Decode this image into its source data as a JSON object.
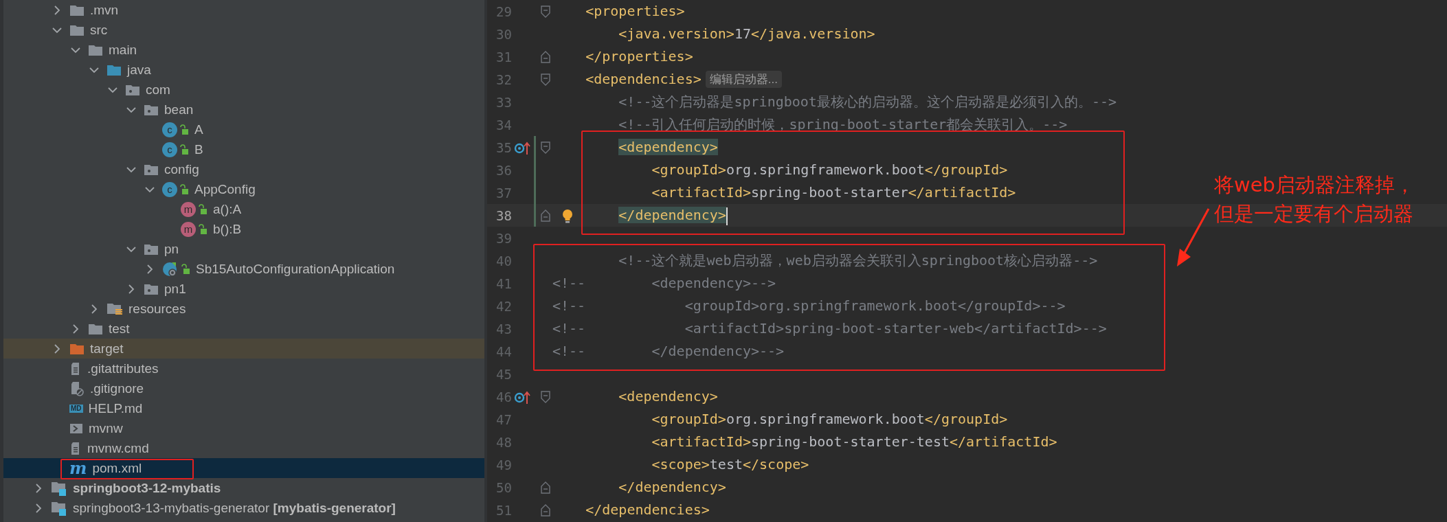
{
  "project_tree": {
    "items": [
      {
        "label": ".mvn",
        "kind": "folder",
        "expanded": false,
        "selected": false
      },
      {
        "label": "src",
        "kind": "folder",
        "expanded": true,
        "selected": false,
        "children": [
          {
            "label": "main",
            "kind": "folder",
            "expanded": true,
            "selected": false,
            "children": [
              {
                "label": "java",
                "kind": "source-root",
                "expanded": true,
                "selected": false,
                "children": [
                  {
                    "label": "com",
                    "kind": "package",
                    "expanded": true,
                    "selected": false,
                    "children": [
                      {
                        "label": "bean",
                        "kind": "package",
                        "expanded": true,
                        "selected": false,
                        "children": [
                          {
                            "label": "A",
                            "kind": "class",
                            "icon_letter": "c",
                            "selected": false
                          },
                          {
                            "label": "B",
                            "kind": "class",
                            "icon_letter": "c",
                            "selected": false
                          }
                        ]
                      },
                      {
                        "label": "config",
                        "kind": "package",
                        "expanded": true,
                        "selected": false,
                        "children": [
                          {
                            "label": "AppConfig",
                            "kind": "class",
                            "icon_letter": "c",
                            "expanded": true,
                            "selected": false,
                            "children": [
                              {
                                "label": "a():A",
                                "kind": "method",
                                "icon_letter": "m",
                                "selected": false
                              },
                              {
                                "label": "b():B",
                                "kind": "method",
                                "icon_letter": "m",
                                "selected": false
                              }
                            ]
                          }
                        ]
                      },
                      {
                        "label": "pn",
                        "kind": "package",
                        "expanded": true,
                        "selected": false,
                        "children": [
                          {
                            "label": "Sb15AutoConfigurationApplication",
                            "kind": "app",
                            "expanded": false,
                            "selected": false
                          }
                        ]
                      },
                      {
                        "label": "pn1",
                        "kind": "package",
                        "expanded": false,
                        "selected": false
                      }
                    ]
                  }
                ]
              },
              {
                "label": "resources",
                "kind": "resources",
                "expanded": false,
                "selected": false
              }
            ]
          },
          {
            "label": "test",
            "kind": "folder",
            "expanded": false,
            "selected": false
          }
        ]
      },
      {
        "label": "target",
        "kind": "excluded",
        "expanded": false,
        "selected": false
      },
      {
        "label": ".gitattributes",
        "kind": "file",
        "selected": false
      },
      {
        "label": ".gitignore",
        "kind": "ignore-file",
        "selected": false
      },
      {
        "label": "HELP.md",
        "kind": "markdown",
        "icon_letter": "MD",
        "selected": false
      },
      {
        "label": "mvnw",
        "kind": "script",
        "selected": false
      },
      {
        "label": "mvnw.cmd",
        "kind": "file",
        "selected": false
      },
      {
        "label": "pom.xml",
        "kind": "maven",
        "icon_letter": "m",
        "selected": true,
        "annotated": true
      }
    ],
    "modules": [
      {
        "label": "springboot3-12-mybatis",
        "kind": "module",
        "bold": true,
        "expanded": false,
        "selected": false
      },
      {
        "label": "springboot3-13-mybatis-generator **[mybatis-generator]**",
        "kind": "module",
        "bold": false,
        "expanded": false,
        "selected": false
      }
    ]
  },
  "editor": {
    "lines": [
      {
        "number": "29",
        "fold_start": true,
        "segments": [
          {
            "kind": "tag",
            "text": "    <properties>"
          }
        ]
      },
      {
        "number": "30",
        "segments": [
          {
            "kind": "tag",
            "text": "        <java.version>"
          },
          {
            "kind": "text",
            "text": "17"
          },
          {
            "kind": "tag",
            "text": "</java.version>"
          }
        ]
      },
      {
        "number": "31",
        "fold_end": true,
        "segments": [
          {
            "kind": "tag",
            "text": "    </properties>"
          }
        ]
      },
      {
        "number": "32",
        "fold_start": true,
        "segments": [
          {
            "kind": "tag",
            "text": "    <dependencies>"
          },
          {
            "kind": "hint",
            "text": "编辑启动器..."
          }
        ]
      },
      {
        "number": "33",
        "segments": [
          {
            "kind": "comment",
            "text": "        <!--这个启动器是springboot最核心的启动器。这个启动器是必须引入的。-->"
          }
        ]
      },
      {
        "number": "34",
        "segments": [
          {
            "kind": "comment",
            "text": "        <!--引入任何启动的时候，spring-boot-starter都会关联引入。-->"
          }
        ]
      },
      {
        "number": "35",
        "boxed": true,
        "fold_start": true,
        "implemented": true,
        "vcs_changed": true,
        "segments": [
          {
            "kind": "tag",
            "text": "        <dependency>",
            "matched": true
          }
        ]
      },
      {
        "number": "36",
        "boxed": true,
        "vcs_changed": true,
        "segments": [
          {
            "kind": "tag",
            "text": "            <groupId>"
          },
          {
            "kind": "text",
            "text": "org.springframework.boot"
          },
          {
            "kind": "tag",
            "text": "</groupId>"
          }
        ]
      },
      {
        "number": "37",
        "boxed": true,
        "vcs_changed": true,
        "segments": [
          {
            "kind": "tag",
            "text": "            <artifactId>"
          },
          {
            "kind": "text",
            "text": "spring-boot-starter"
          },
          {
            "kind": "tag",
            "text": "</artifactId>"
          }
        ]
      },
      {
        "number": "38",
        "boxed": true,
        "fold_end": true,
        "current": true,
        "bulb": true,
        "vcs_changed": true,
        "segments": [
          {
            "kind": "tag",
            "text": "        </dependency>",
            "matched": true
          }
        ]
      },
      {
        "number": "39"
      },
      {
        "number": "40",
        "boxed": true,
        "segments": [
          {
            "kind": "comment",
            "text": "        <!--这个就是web启动器，web启动器会关联引入springboot核心启动器-->"
          }
        ]
      },
      {
        "number": "41",
        "boxed": true,
        "segments": [
          {
            "kind": "comment",
            "text": "<!--        <dependency>-->"
          }
        ]
      },
      {
        "number": "42",
        "boxed": true,
        "segments": [
          {
            "kind": "comment",
            "text": "<!--            <groupId>org.springframework.boot</groupId>-->"
          }
        ]
      },
      {
        "number": "43",
        "boxed": true,
        "segments": [
          {
            "kind": "comment",
            "text": "<!--            <artifactId>spring-boot-starter-web</artifactId>-->"
          }
        ]
      },
      {
        "number": "44",
        "boxed": true,
        "segments": [
          {
            "kind": "comment",
            "text": "<!--        </dependency>-->"
          }
        ]
      },
      {
        "number": "45"
      },
      {
        "number": "46",
        "fold_start": true,
        "implemented": true,
        "segments": [
          {
            "kind": "tag",
            "text": "        <dependency>"
          }
        ]
      },
      {
        "number": "47",
        "segments": [
          {
            "kind": "tag",
            "text": "            <groupId>"
          },
          {
            "kind": "text",
            "text": "org.springframework.boot"
          },
          {
            "kind": "tag",
            "text": "</groupId>"
          }
        ]
      },
      {
        "number": "48",
        "segments": [
          {
            "kind": "tag",
            "text": "            <artifactId>"
          },
          {
            "kind": "text",
            "text": "spring-boot-starter-test"
          },
          {
            "kind": "tag",
            "text": "</artifactId>"
          }
        ]
      },
      {
        "number": "49",
        "segments": [
          {
            "kind": "tag",
            "text": "            <scope>"
          },
          {
            "kind": "text",
            "text": "test"
          },
          {
            "kind": "tag",
            "text": "</scope>"
          }
        ]
      },
      {
        "number": "50",
        "fold_end": true,
        "segments": [
          {
            "kind": "tag",
            "text": "        </dependency>"
          }
        ]
      },
      {
        "number": "51",
        "fold_end": true,
        "segments": [
          {
            "kind": "tag",
            "text": "    </dependencies>"
          }
        ]
      }
    ],
    "note": {
      "lines": [
        "将web启动器注释掉，",
        "但是一定要有个启动器"
      ]
    }
  }
}
